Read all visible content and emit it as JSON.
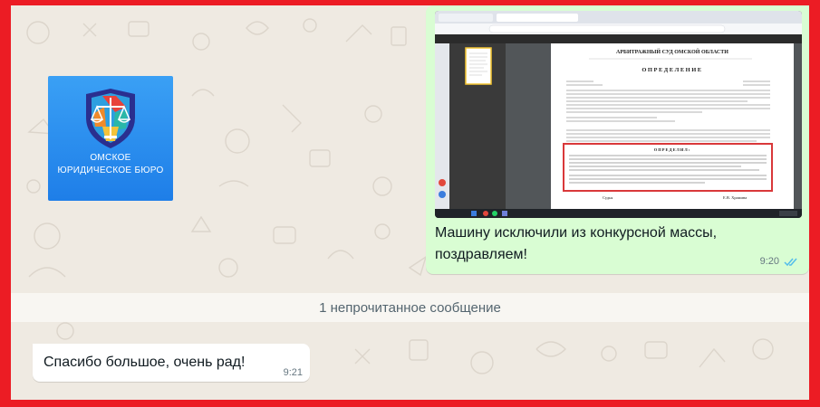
{
  "logo": {
    "line1": "ОМСКОЕ",
    "line2": "ЮРИДИЧЕСКОЕ БЮРО"
  },
  "outgoing": {
    "text": "Машину исключили из конкурсной массы, поздравляем!",
    "time": "9:20",
    "status_icon": "double-check-read-icon"
  },
  "screenshot": {
    "court_title": "АРБИТРАЖНЫЙ СУД ОМСКОЙ ОБЛАСТИ",
    "document_title": "ОПРЕДЕЛЕНИЕ",
    "section": "ОПРЕДЕЛИЛ:",
    "signature_left": "Судья",
    "signature_right": "Е.В. Храмина",
    "highlight_color": "#d9383a"
  },
  "unread_divider": "1 непрочитанное сообщение",
  "incoming": {
    "text": "Спасибо большое, очень рад!",
    "time": "9:21"
  },
  "colors": {
    "frame": "#ec1c24",
    "chat_background": "#efeae2",
    "outgoing_bubble": "#d9fdd3",
    "incoming_bubble": "#ffffff",
    "read_ticks": "#53bdeb"
  }
}
